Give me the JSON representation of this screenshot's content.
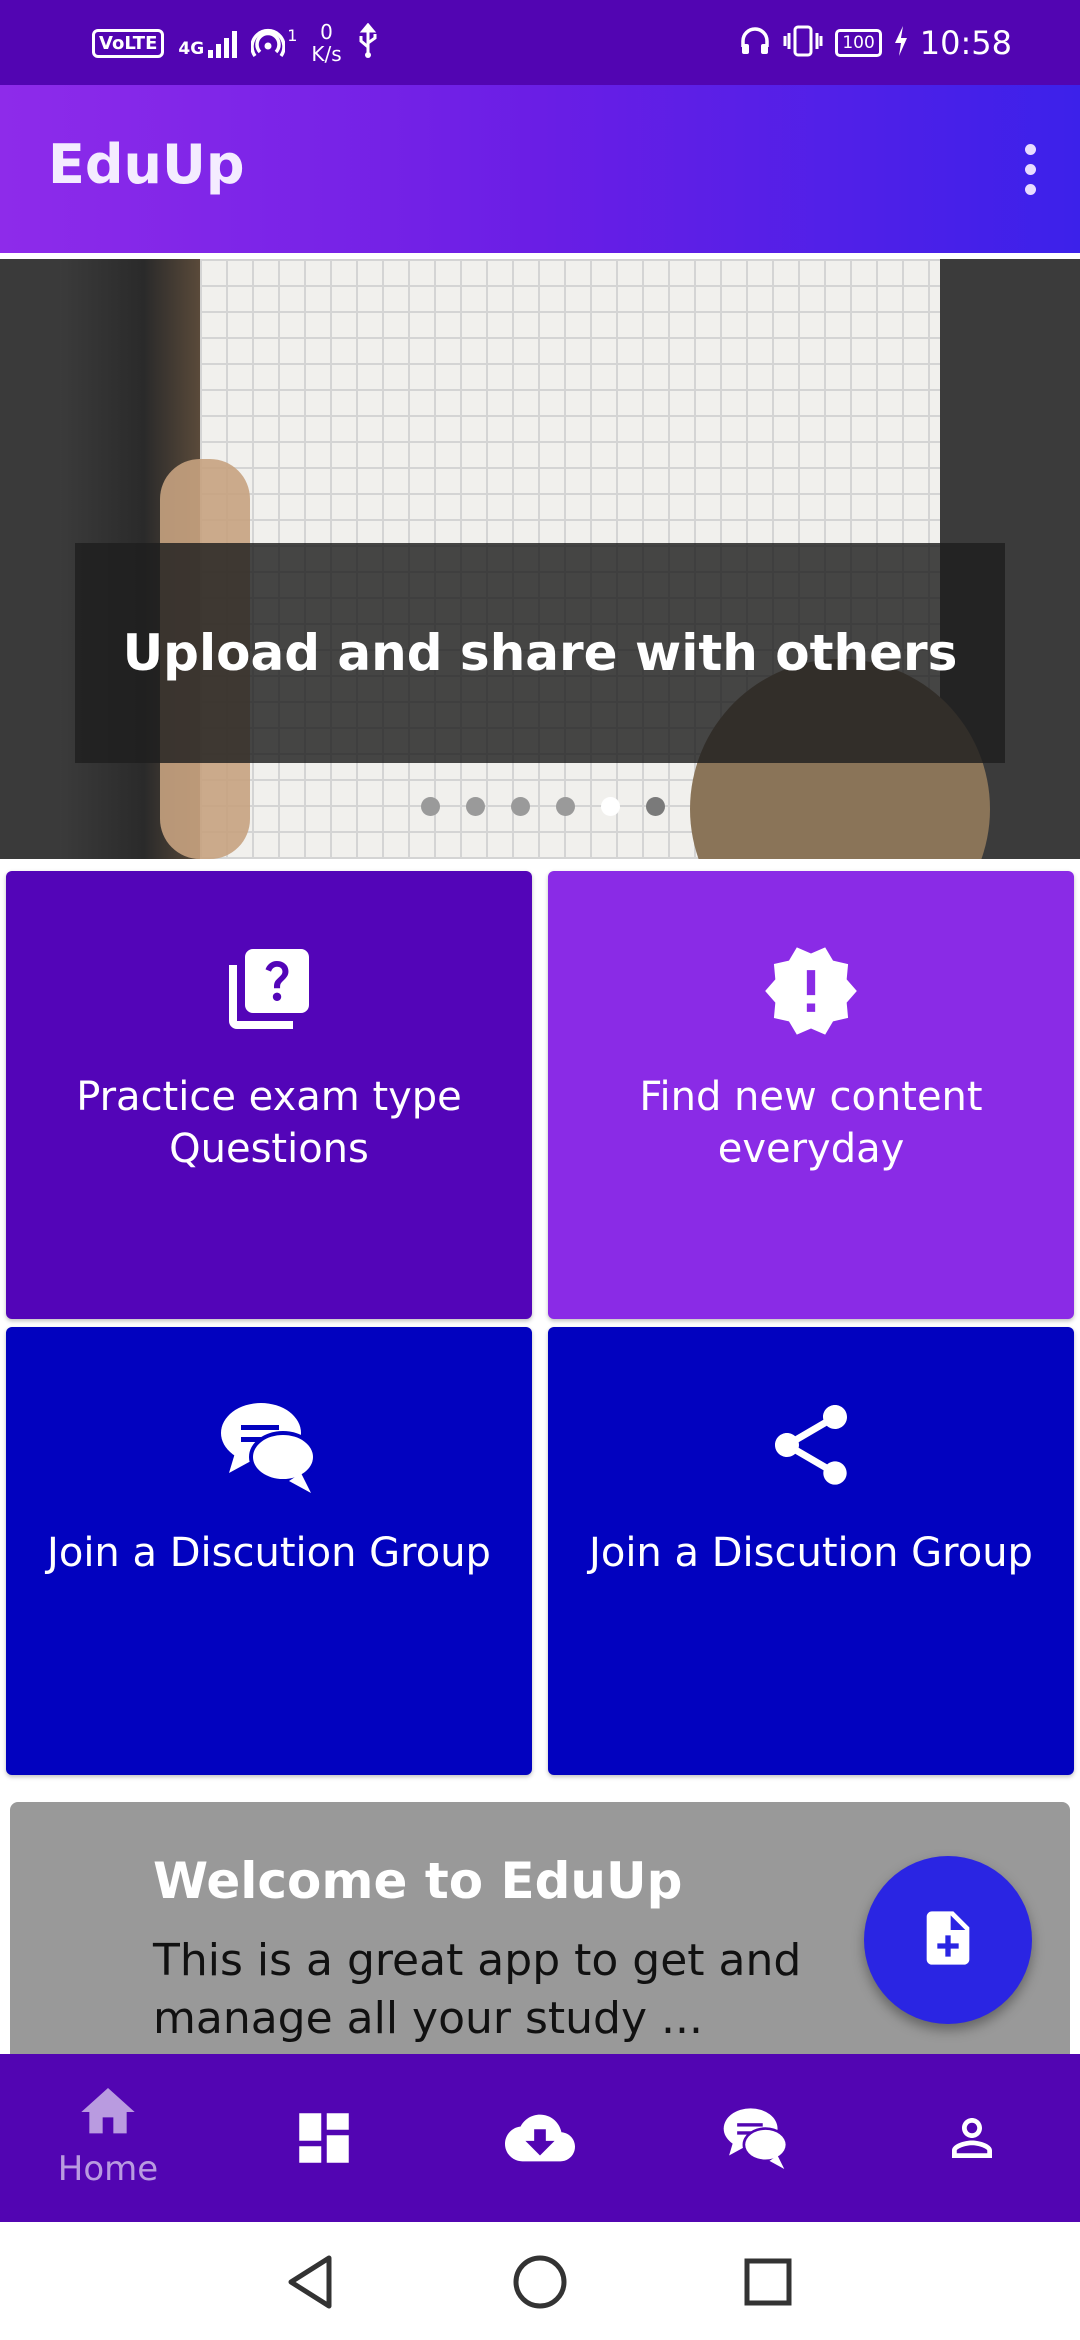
{
  "status_bar": {
    "volte": "VoLTE",
    "network": "4G",
    "hotspot_count": "1",
    "speed_value": "0",
    "speed_unit": "K/s",
    "battery": "100",
    "time": "10:58",
    "icons": [
      "volte-icon",
      "signal-icon",
      "hotspot-icon",
      "usb-icon",
      "headphones-icon",
      "vibrate-icon",
      "battery-icon",
      "charging-icon"
    ]
  },
  "app_bar": {
    "title": "EduUp",
    "menu_icon": "more-vert-icon"
  },
  "carousel": {
    "caption": "Upload and share with others",
    "page_count": 6,
    "active_page": 5
  },
  "tiles": [
    {
      "label": "Practice exam type Questions",
      "icon": "quiz-icon",
      "color": "#5305b8"
    },
    {
      "label": "Find new content everyday",
      "icon": "new-releases-icon",
      "color": "#8a2be6"
    },
    {
      "label": "Join a Discution Group",
      "icon": "forum-icon",
      "color": "#0202bf"
    },
    {
      "label": "Join a Discution Group",
      "icon": "share-icon",
      "color": "#0202bf"
    }
  ],
  "welcome": {
    "title": "Welcome to EduUp",
    "body": "This is a great app to get and manage all your study ..."
  },
  "fab": {
    "icon": "note-add-icon",
    "color": "#2a25e3"
  },
  "bottom_nav": {
    "items": [
      {
        "label": "Home",
        "icon": "home-icon",
        "active": true
      },
      {
        "label": "",
        "icon": "dashboard-icon"
      },
      {
        "label": "",
        "icon": "cloud-download-icon"
      },
      {
        "label": "",
        "icon": "chat-icon"
      },
      {
        "label": "",
        "icon": "person-icon"
      }
    ]
  },
  "system_nav": {
    "icons": [
      "back-icon",
      "home-circle-icon",
      "recents-icon"
    ]
  },
  "colors": {
    "primary_dark": "#5205b2",
    "accent": "#8a2be6",
    "tile_blue": "#0202bf"
  }
}
